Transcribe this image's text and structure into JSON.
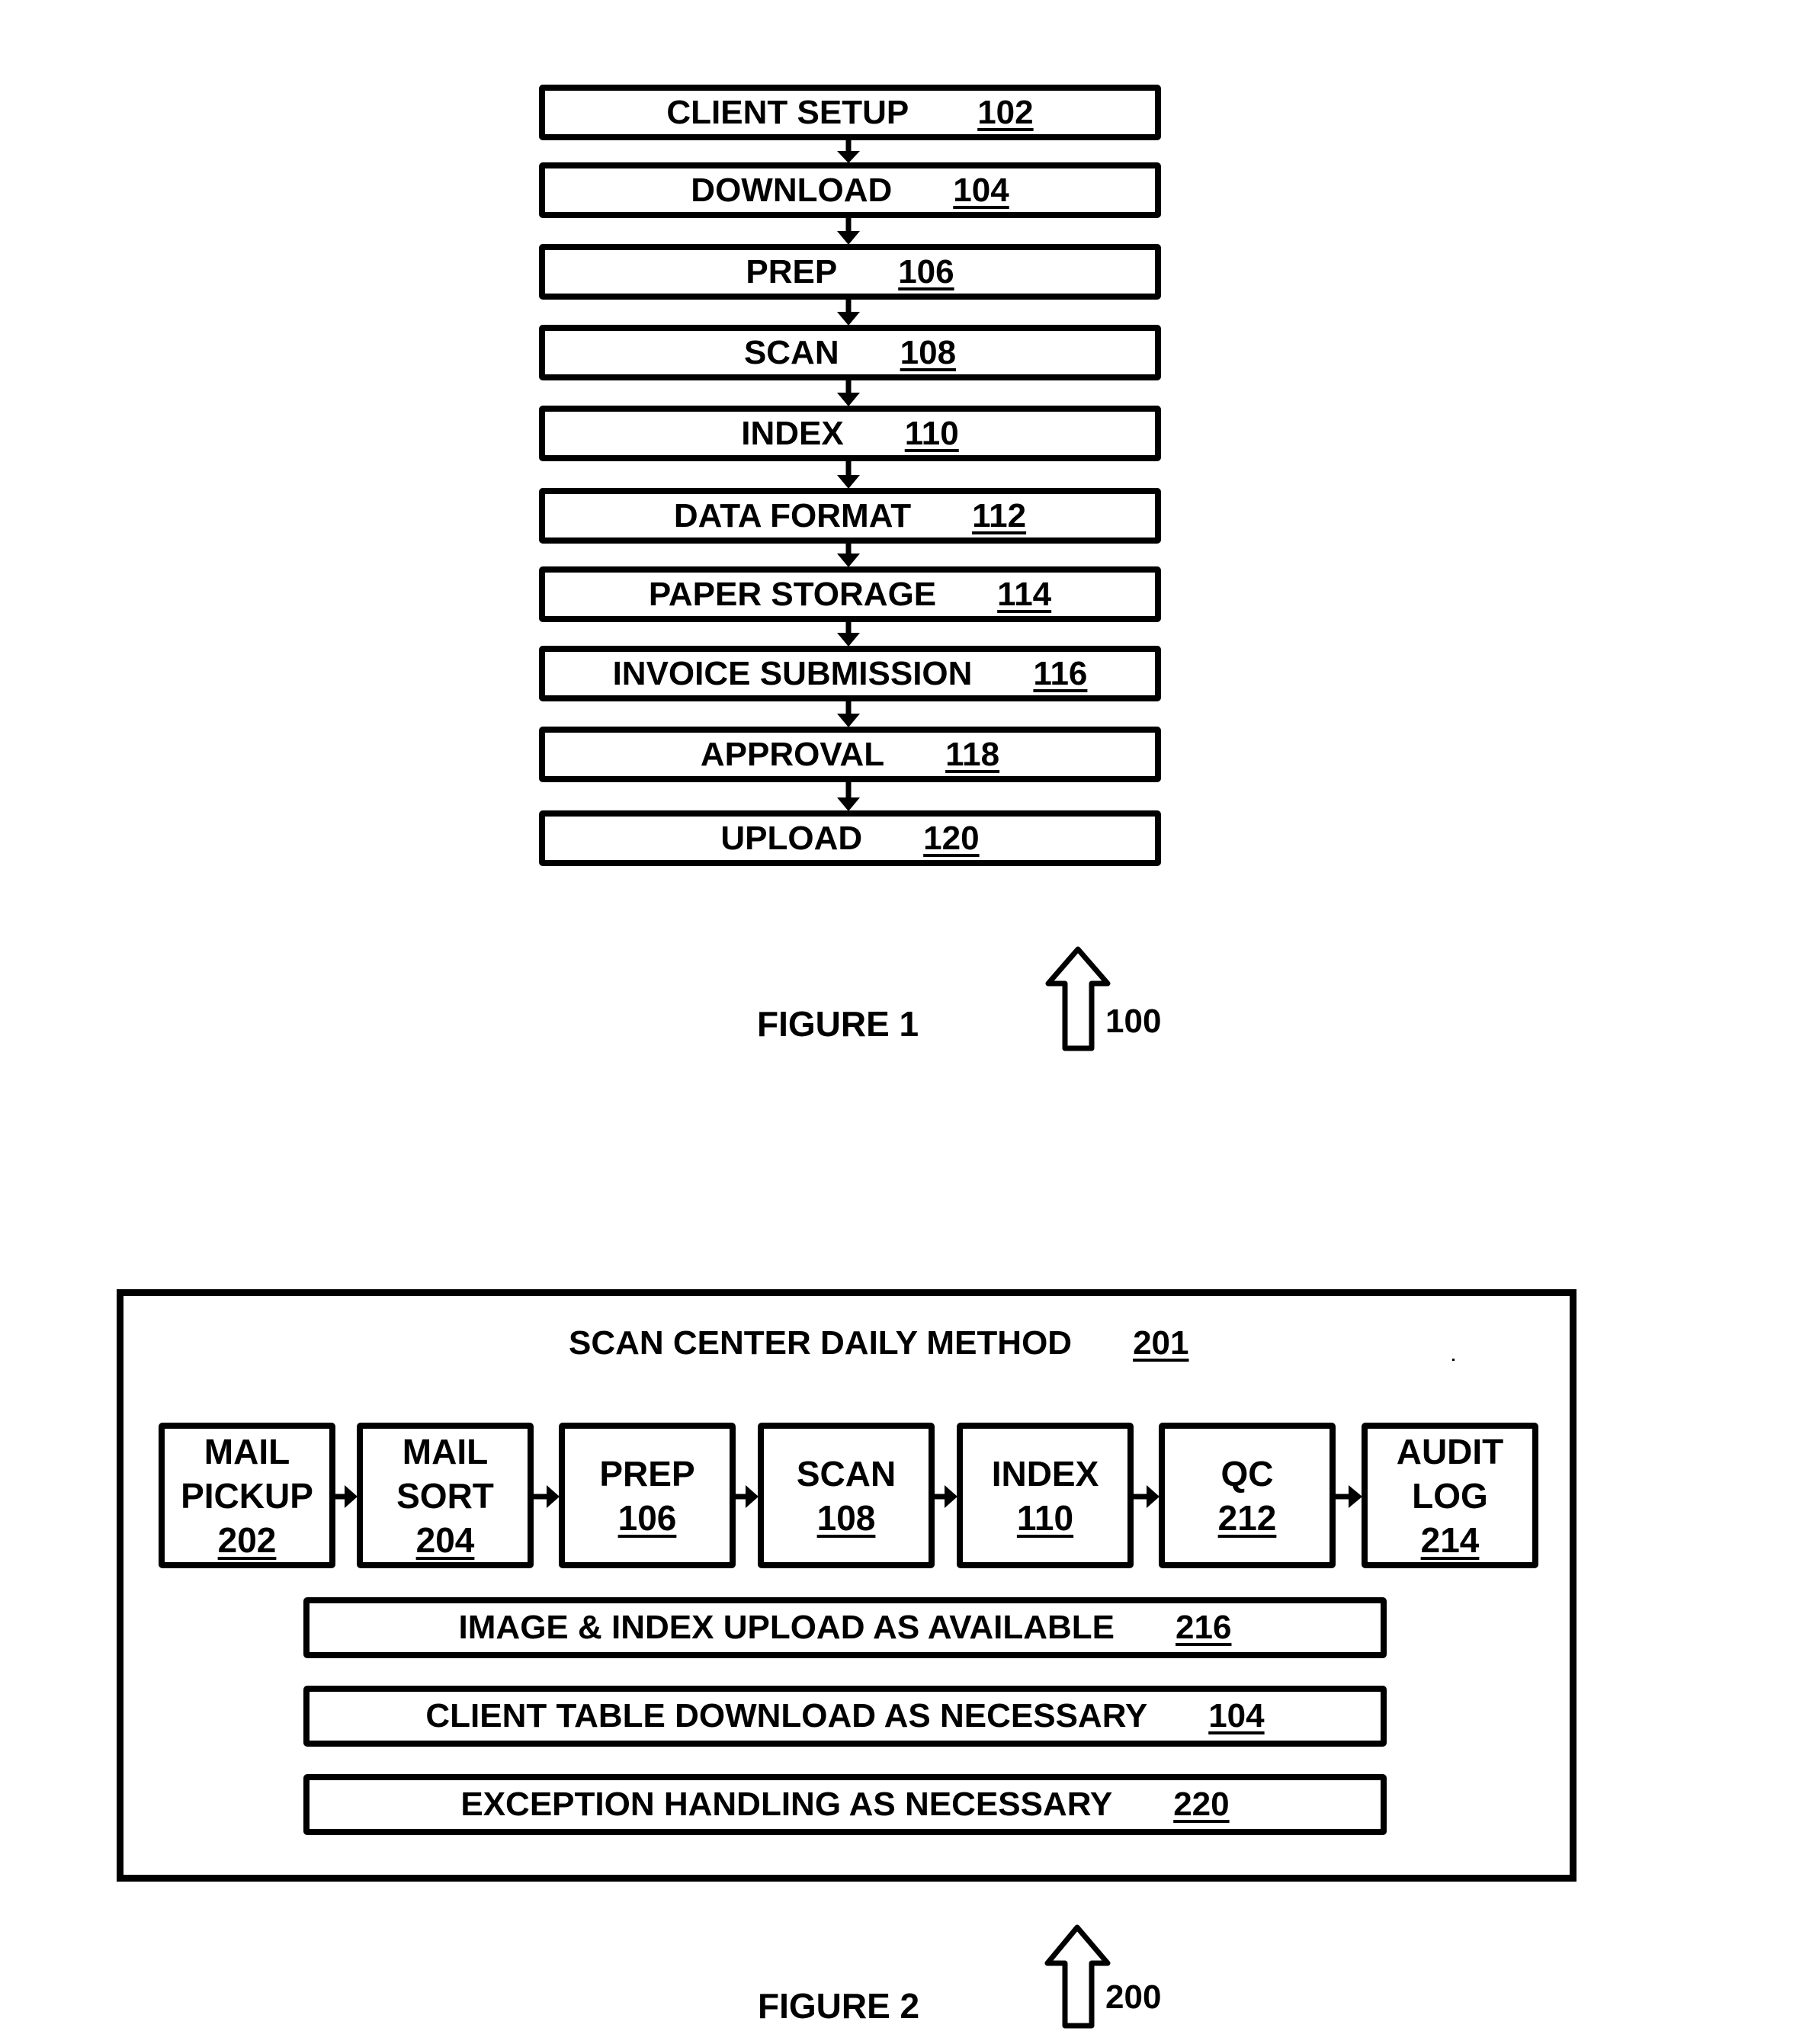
{
  "figure1": {
    "caption": "FIGURE 1",
    "ref": "100",
    "steps": [
      {
        "label": "CLIENT SETUP",
        "ref": "102"
      },
      {
        "label": "DOWNLOAD",
        "ref": "104"
      },
      {
        "label": "PREP",
        "ref": "106"
      },
      {
        "label": "SCAN",
        "ref": "108"
      },
      {
        "label": "INDEX",
        "ref": "110"
      },
      {
        "label": "DATA FORMAT",
        "ref": "112"
      },
      {
        "label": "PAPER STORAGE",
        "ref": "114"
      },
      {
        "label": "INVOICE SUBMISSION",
        "ref": "116"
      },
      {
        "label": "APPROVAL",
        "ref": "118"
      },
      {
        "label": "UPLOAD",
        "ref": "120"
      }
    ]
  },
  "figure2": {
    "caption": "FIGURE 2",
    "ref": "200",
    "title": "SCAN CENTER DAILY METHOD",
    "title_ref": "201",
    "steps": [
      {
        "line1": "MAIL",
        "line2": "PICKUP",
        "ref": "202"
      },
      {
        "line1": "MAIL",
        "line2": "SORT",
        "ref": "204"
      },
      {
        "line1": "PREP",
        "line2": "",
        "ref": "106"
      },
      {
        "line1": "SCAN",
        "line2": "",
        "ref": "108"
      },
      {
        "line1": "INDEX",
        "line2": "",
        "ref": "110"
      },
      {
        "line1": "QC",
        "line2": "",
        "ref": "212"
      },
      {
        "line1": "AUDIT",
        "line2": "LOG",
        "ref": "214"
      }
    ],
    "bars": [
      {
        "label": "IMAGE & INDEX UPLOAD AS AVAILABLE",
        "ref": "216"
      },
      {
        "label": "CLIENT TABLE DOWNLOAD AS NECESSARY",
        "ref": "104"
      },
      {
        "label": "EXCEPTION HANDLING AS NECESSARY",
        "ref": "220"
      }
    ]
  }
}
